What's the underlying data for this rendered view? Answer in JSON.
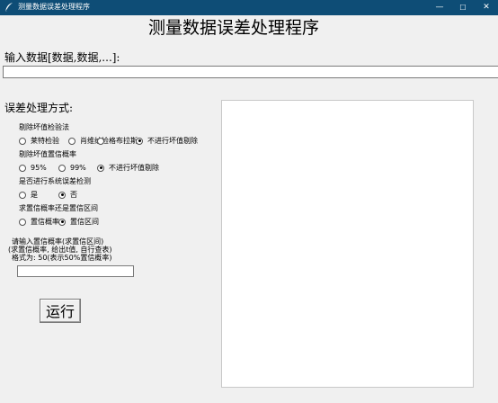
{
  "window": {
    "title": "测量数据误差处理程序",
    "minimize": "—",
    "maximize": "☐",
    "close": "✕"
  },
  "header": {
    "title": "测量数据误差处理程序"
  },
  "data_input": {
    "label": "输入数据[数据,数据,...]:",
    "value": ""
  },
  "method": {
    "label": "误差处理方式:",
    "groups": [
      {
        "label": "剔除坏值检验法",
        "options": [
          {
            "label": "莱特检验",
            "selected": false
          },
          {
            "label": "肖维纳检",
            "selected": false
          },
          {
            "label": "格布拉斯",
            "selected": false
          },
          {
            "label": "不进行坏值剔除",
            "selected": true
          }
        ]
      },
      {
        "label": "剔除坏值置信概率",
        "options": [
          {
            "label": "95%",
            "selected": false
          },
          {
            "label": "99%",
            "selected": false
          },
          {
            "label": "不进行坏值剔除",
            "selected": true
          }
        ]
      },
      {
        "label": "是否进行系统误差检测",
        "options": [
          {
            "label": "是",
            "selected": false
          },
          {
            "label": "否",
            "selected": true
          }
        ]
      },
      {
        "label": "求置信概率还是置信区间",
        "options": [
          {
            "label": "置信概率",
            "selected": false
          },
          {
            "label": "置信区间",
            "selected": true
          }
        ]
      }
    ]
  },
  "confidence": {
    "prompt_line1": "请输入置信概率(求置信区间)",
    "prompt_line2": "(求置信概率, 给出t值, 自行查表)",
    "prompt_line3": "格式为: 50(表示50%置信概率)",
    "value": ""
  },
  "run_button": {
    "label": "运行"
  },
  "output": {
    "text": ""
  }
}
